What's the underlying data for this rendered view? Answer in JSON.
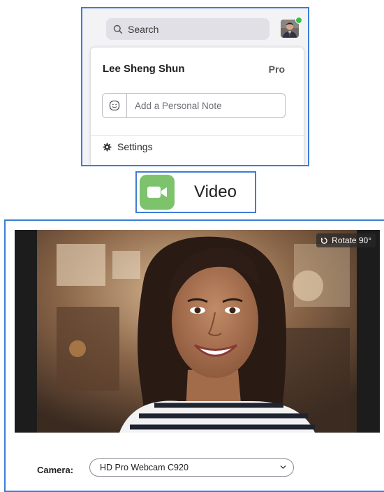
{
  "search": {
    "label": "Search"
  },
  "profile": {
    "name": "Lee Sheng Shun",
    "plan": "Pro",
    "note_placeholder": "Add a Personal Note",
    "status_color": "#39c04a"
  },
  "menu": {
    "settings_label": "Settings"
  },
  "video_tile": {
    "label": "Video",
    "icon": "video-camera-icon",
    "accent": "#7cc36c"
  },
  "video_settings": {
    "rotate_label": "Rotate 90°",
    "camera_label": "Camera:",
    "camera_selected": "HD Pro Webcam C920"
  },
  "colors": {
    "highlight_border": "#3b7dd8"
  }
}
